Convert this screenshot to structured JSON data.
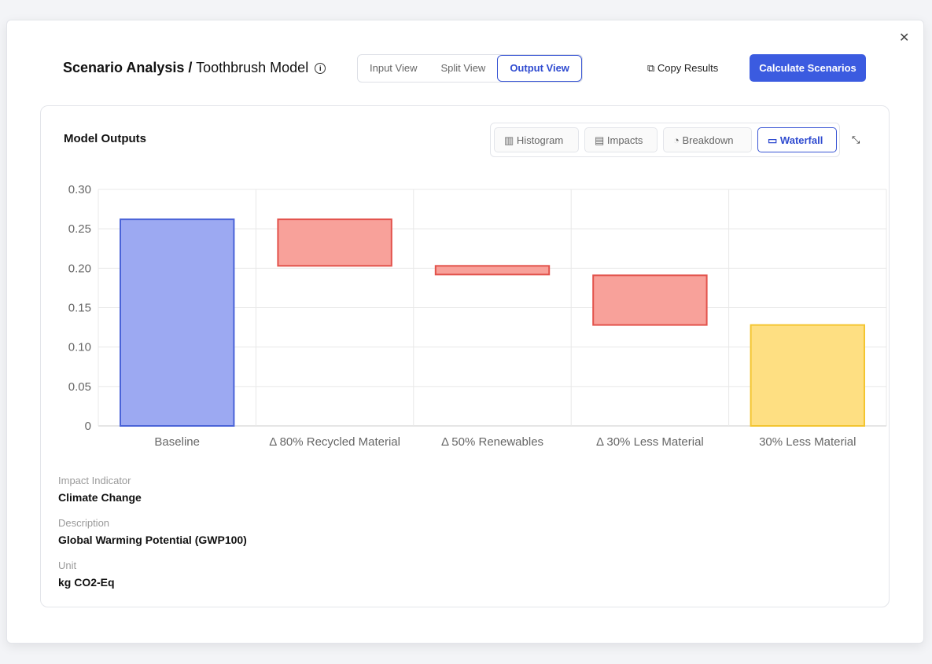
{
  "header": {
    "title_bold": "Scenario Analysis /",
    "title_rest": "Toothbrush Model",
    "views": [
      "Input View",
      "Split View",
      "Output View"
    ],
    "active_view": "Output View",
    "copy": "Copy Results",
    "calculate": "Calculate Scenarios"
  },
  "card": {
    "title": "Model Outputs",
    "tabs": [
      "Histogram",
      "Impacts",
      "Breakdown",
      "Waterfall"
    ],
    "active_tab": "Waterfall"
  },
  "meta": [
    {
      "label": "Impact Indicator",
      "value": "Climate Change"
    },
    {
      "label": "Description",
      "value": "Global Warming Potential (GWP100)"
    },
    {
      "label": "Unit",
      "value": "kg CO2-Eq"
    }
  ],
  "chart_data": {
    "type": "bar",
    "subtype": "waterfall",
    "categories": [
      "Baseline",
      "Δ 80% Recycled Material",
      "Δ 50% Renewables",
      "Δ 30% Less Material",
      "30% Less Material"
    ],
    "bars": [
      {
        "start": 0,
        "end": 0.262,
        "kind": "total"
      },
      {
        "start": 0.262,
        "end": 0.203,
        "kind": "delta"
      },
      {
        "start": 0.203,
        "end": 0.192,
        "kind": "delta"
      },
      {
        "start": 0.191,
        "end": 0.128,
        "kind": "delta"
      },
      {
        "start": 0,
        "end": 0.128,
        "kind": "result"
      }
    ],
    "yticks": [
      "0",
      "0.05",
      "0.10",
      "0.15",
      "0.20",
      "0.25",
      "0.30"
    ],
    "ylim": [
      0,
      0.3
    ],
    "colors": {
      "total": [
        "#9ca9f2",
        "#4a63d8"
      ],
      "delta": [
        "#f8a19a",
        "#e2524b"
      ],
      "result": [
        "#fedf82",
        "#f3c530"
      ]
    }
  }
}
